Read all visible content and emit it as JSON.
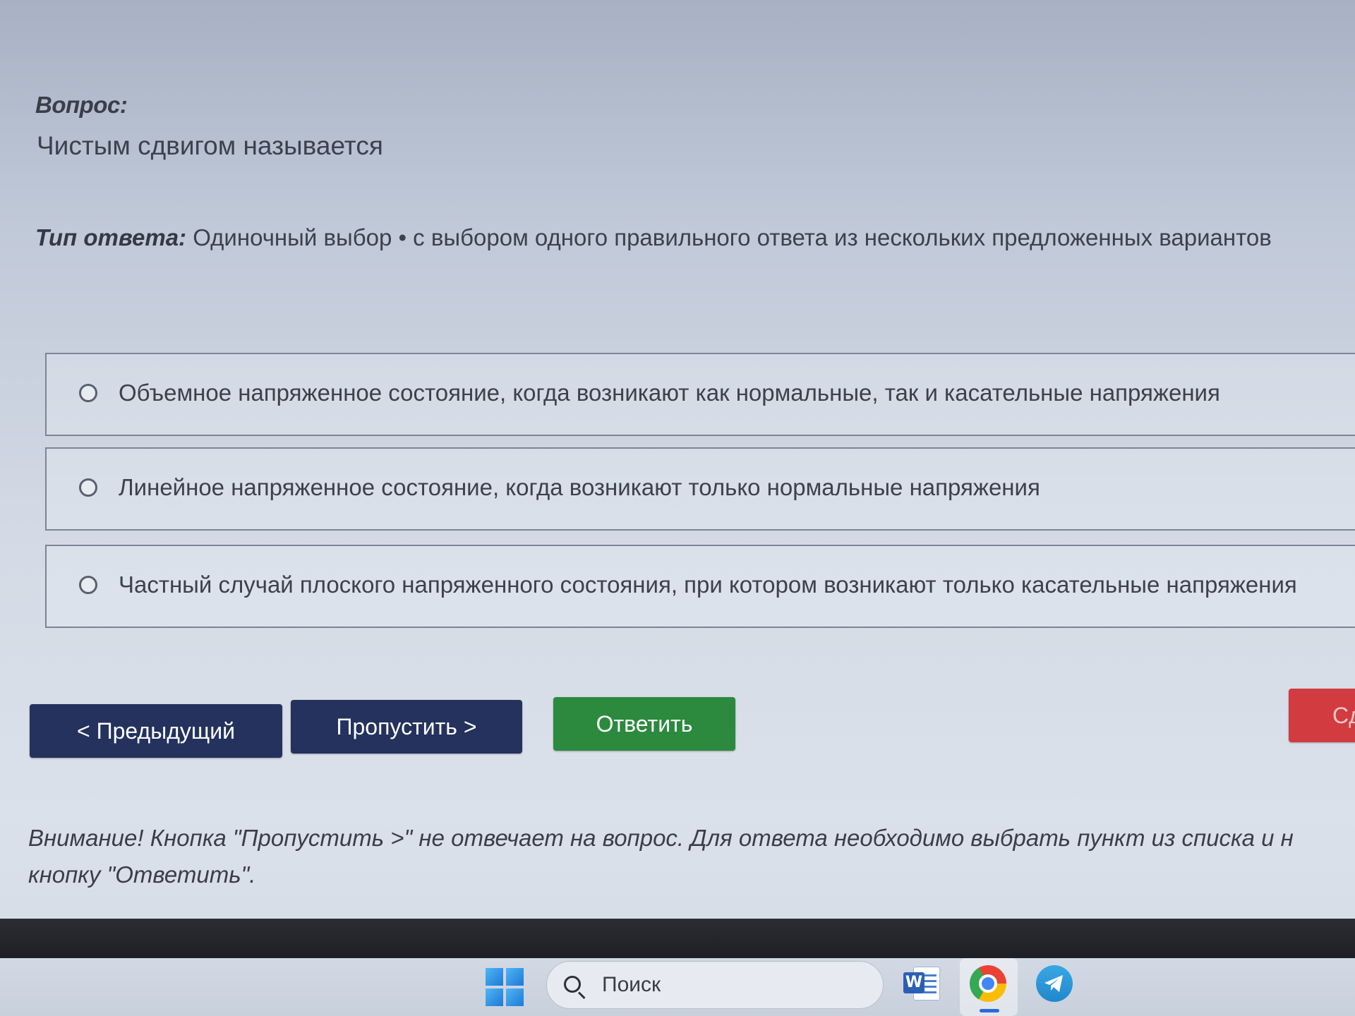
{
  "question": {
    "label": "Вопрос:",
    "text": "Чистым сдвигом называется"
  },
  "answer_type": {
    "label": "Тип ответа:",
    "value": " Одиночный выбор • с выбором одного правильного ответа из нескольких предложенных вариантов"
  },
  "options": [
    {
      "text": "Объемное напряженное состояние, когда возникают как нормальные, так и касательные напряжения",
      "selected": false
    },
    {
      "text": "Линейное напряженное состояние, когда возникают только нормальные напряжения",
      "selected": false
    },
    {
      "text": "Частный случай плоского напряженного состояния, при котором возникают только касательные напряжения",
      "selected": false
    }
  ],
  "buttons": {
    "prev": "< Предыдущий",
    "skip": "Пропустить >",
    "answer": "Ответить",
    "end": "Сд"
  },
  "warning": {
    "line1": "Внимание! Кнопка \"Пропустить >\" не отвечает на вопрос. Для ответа необходимо выбрать пункт из списка и н",
    "line2": "кнопку \"Ответить\"."
  },
  "taskbar": {
    "search_placeholder": "Поиск",
    "apps": [
      "windows-start-icon",
      "word-icon",
      "chrome-icon",
      "telegram-icon"
    ]
  },
  "colors": {
    "nav_button": "#24325d",
    "answer_button": "#2b8a3e",
    "end_button": "#d23b40"
  }
}
